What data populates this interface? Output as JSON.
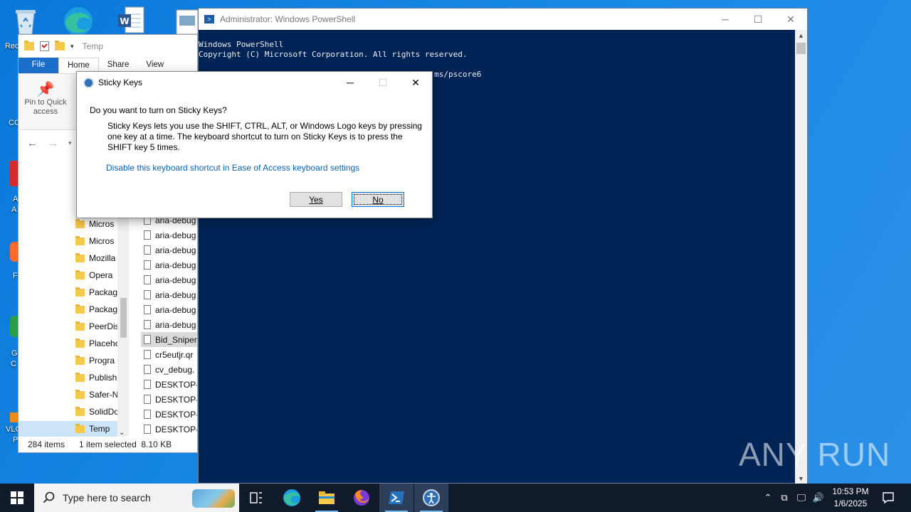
{
  "desktop": {
    "icons": [
      {
        "name": "recycle-bin",
        "label": "Rec"
      },
      {
        "name": "cc",
        "label": "CC"
      },
      {
        "name": "a",
        "label": "A"
      },
      {
        "name": "a2",
        "label": "A"
      },
      {
        "name": "f",
        "label": "F"
      },
      {
        "name": "g",
        "label": "G"
      },
      {
        "name": "c",
        "label": "C"
      },
      {
        "name": "vlc",
        "label": "VLC"
      },
      {
        "name": "p",
        "label": "P"
      }
    ]
  },
  "explorer": {
    "title": "Temp",
    "tabs": {
      "file": "File",
      "home": "Home",
      "share": "Share",
      "view": "View"
    },
    "pin_label": "Pin to Quick access",
    "nav_items": [
      "Micros",
      "Micros",
      "Mozilla",
      "Opera",
      "Packag",
      "Packag",
      "PeerDis",
      "Placeho",
      "Progra",
      "Publish",
      "Safer-N",
      "SolidDo",
      "Temp"
    ],
    "files": [
      "aria-debug",
      "aria-debug",
      "aria-debug",
      "aria-debug",
      "aria-debug",
      "aria-debug",
      "aria-debug",
      "aria-debug",
      "Bid_Sniper",
      "cr5eutjr.qr",
      "cv_debug.",
      "DESKTOP-",
      "DESKTOP-",
      "DESKTOP-",
      "DESKTOP-"
    ],
    "status": {
      "items": "284 items",
      "selected": "1 item selected",
      "size": "8.10 KB"
    }
  },
  "powershell": {
    "title": "Administrator: Windows PowerShell",
    "lines": [
      "Windows PowerShell",
      "Copyright (C) Microsoft Corporation. All rights reserved.",
      "",
      "Try the new cross-platform PowerShell https://aka.ms/pscore6"
    ]
  },
  "dialog": {
    "title": "Sticky Keys",
    "question": "Do you want to turn on Sticky Keys?",
    "description": "Sticky Keys lets you use the SHIFT, CTRL, ALT, or Windows Logo keys by pressing one key at a time. The keyboard shortcut to turn on Sticky Keys is to press the SHIFT key 5 times.",
    "link": "Disable this keyboard shortcut in Ease of Access keyboard settings",
    "yes_label": "Yes",
    "no_label": "No"
  },
  "watermark": "ANY RUN",
  "taskbar": {
    "search_placeholder": "Type here to search",
    "time": "10:53 PM",
    "date": "1/6/2025"
  },
  "colors": {
    "powershell_bg": "#012456",
    "desktop_bg": "#1a8ae8",
    "taskbar_bg": "#101a2a",
    "link": "#0b63b8"
  }
}
